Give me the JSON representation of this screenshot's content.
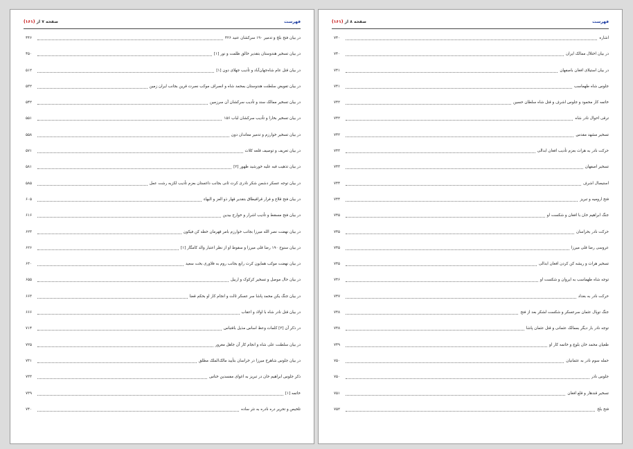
{
  "right": {
    "header_title": "فهرست",
    "header_page": "صفحه ۸ از ",
    "header_total": "(۱۶۱)",
    "entries": [
      {
        "title": "اشاره",
        "page": "۷۴۰"
      },
      {
        "title": "در بیان اختلال ممالک ایران",
        "page": "۷۴۰"
      },
      {
        "title": "در بیان استیلای افغان باصفهان",
        "page": "۷۴۱"
      },
      {
        "title": "جلوس شاه طهماسب",
        "page": "۷۴۱"
      },
      {
        "title": "خاتمه کار محمود و جلوس اشرف و قتل شاه سلطان حسین",
        "page": "۷۴۲"
      },
      {
        "title": "ترقی احوال نادر شاه",
        "page": "۷۴۲"
      },
      {
        "title": "تسخیر مشهد مقدس",
        "page": "۷۴۲"
      },
      {
        "title": "حرکت نادر به هرات بعزم تأدیب افغان ابدالی",
        "page": "۷۴۳"
      },
      {
        "title": "تسخیر اصفهان",
        "page": "۷۴۳"
      },
      {
        "title": "استیصال اشرف",
        "page": "۷۴۴"
      },
      {
        "title": "فتح ارومیه و تبریز",
        "page": "۷۴۴"
      },
      {
        "title": "جنگ ابراهیم خان با افغان و شکست او",
        "page": "۷۴۵"
      },
      {
        "title": "حرکت نادر بخراسان",
        "page": "۷۴۵"
      },
      {
        "title": "عروسی رضا قلی میرزا",
        "page": "۷۴۵"
      },
      {
        "title": "تسخیر هرات و ریشه کن کردن افغان ابدالی",
        "page": "۷۴۵"
      },
      {
        "title": "توجه شاه طهماسب به ایروان و شکست او",
        "page": "۷۴۶"
      },
      {
        "title": "حرکت نادر به بغداد",
        "page": "۷۴۷"
      },
      {
        "title": "جنگ توپال عثمان سرعسکر و شکست لشکر بعد از فتح",
        "page": "۷۴۸"
      },
      {
        "title": "توجه نادر بار دیگر بممالک عثمانی و قتل عثمان پاشا",
        "page": "۷۴۸"
      },
      {
        "title": "طغیان محمد خان بلوچ و خاتمه کار او",
        "page": "۷۴۹"
      },
      {
        "title": "حمله سوم نادر به عثمانیان",
        "page": "۷۵۰"
      },
      {
        "title": "جلوس نادر",
        "page": "۷۵۰"
      },
      {
        "title": "تسخیر قندهار و قلع افغان",
        "page": "۷۵۱"
      },
      {
        "title": "فتح بلخ",
        "page": "۷۵۲"
      }
    ]
  },
  "left": {
    "header_title": "فهرست",
    "header_page": "صفحه ۷ از ",
    "header_total": "(۱۶۱)",
    "entries": [
      {
        "title": "در بیان فتح بلخ و تدمیر ۱۹۰ سرکشان عنید ۴۲۶",
        "page": "۴۴۶"
      },
      {
        "title": "در بیان تسخیر هندوستان بتقدیر خالق ظلمت و نور [۱]",
        "page": "۴۵۰"
      },
      {
        "title": "در بیان قتل عام شاه‌جهان‌آباد و تأدیب جهلای دون [۱]",
        "page": "۵۱۲"
      },
      {
        "title": "در بیان تفویض سلطنت هندوستان بمحمد شاه و انصراف موکب نصرت قرین بجانب ایران زمین",
        "page": "۵۳۲"
      },
      {
        "title": "در بیان تسخیر ممالک سند و تأدیب سرکشان آن سرزمین",
        "page": "۵۴۲"
      },
      {
        "title": "در بیان تسخیر بخارا و تأدیب سرکشان لباب ۱۵۶",
        "page": "۵۵۱"
      },
      {
        "title": "در بیان تسخیر خوارزم و تدمیر معاندان دون",
        "page": "۵۵۸"
      },
      {
        "title": "در بیان تعریف و توصیف قلعه کلات",
        "page": "۵۷۱"
      },
      {
        "title": "در بیان تذهیب قبه علیه خورشید ظهور [۲]",
        "page": "۵۸۱"
      },
      {
        "title": "در بیان توجه عسکر دشمن شکر نادری کرت ثانی بجانب داغستان بعزم تأدیب لکزیه رشت عمل",
        "page": "۵۸۵"
      },
      {
        "title": "در بیان فتح قلاع و فرار قراقیطاق بتقدیر قهار ذو العز و البهاء",
        "page": "۶۰۵"
      },
      {
        "title": "در بیان فتح مسقط و تأدیب اشرار و خوارج بیدین",
        "page": "۶۱۶"
      },
      {
        "title": "در بیان نهضت نصر الله میرزا بجانب خوارزم بامر قهرمان خطه کن فیکون",
        "page": "۶۲۳"
      },
      {
        "title": "در بیان سنوح ۱۹۰ رضا قلی میرزا و سقوط او از نظر اعتبار والد کامگار [۱]",
        "page": "۶۲۶"
      },
      {
        "title": "در بیان نهضت موکب همایون کرت رابع بجانب روم به فلاوری بخت سعید",
        "page": "۶۳۰"
      },
      {
        "title": "در بیان حال موصل و تسخیر کرکوک و اربیل",
        "page": "۶۵۵"
      },
      {
        "title": "در بیان جنگ یکن محمد پاشا سر عسکر ثالث و انجام کار او بحکم قضا",
        "page": "۶۶۳"
      },
      {
        "title": "در بیان قتل نادر شاه با اولاد و اعقاب",
        "page": "۶۶۶"
      },
      {
        "title": "در ذکر آن [۳] کلمات وعظ اساس مذیل باقتباس",
        "page": "۷۱۴"
      },
      {
        "title": "در بیان سلطنت علی شاه و انجام کار آن جاهل مغرور",
        "page": "۷۲۵"
      },
      {
        "title": "در بیان جلوس شاهرخ میرزا در خراسان بتأیید مالک‌الملک مطلق",
        "page": "۷۳۱"
      },
      {
        "title": "ذکر جلوس ابراهیم خان در تبریز به اغوای مفسدین خناس",
        "page": "۷۳۳"
      },
      {
        "title": "خاتمه [۱]",
        "page": "۷۳۹"
      },
      {
        "title": "تلخیص و تحریر دره نادره به نثر ساده",
        "page": "۷۴۰"
      }
    ]
  }
}
